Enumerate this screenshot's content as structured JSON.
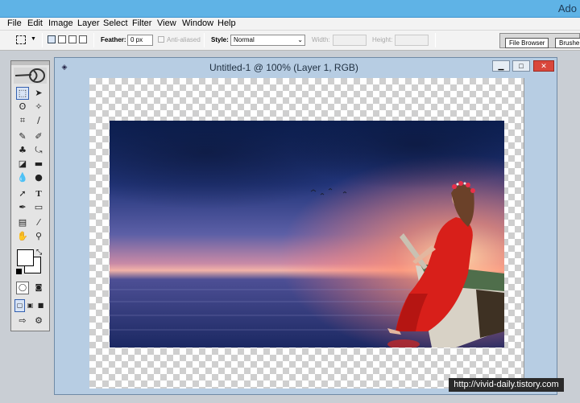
{
  "app": {
    "title": "Ado"
  },
  "menu": [
    "File",
    "Edit",
    "Image",
    "Layer",
    "Select",
    "Filter",
    "View",
    "Window",
    "Help"
  ],
  "options": {
    "feather_label": "Feather:",
    "feather_value": "0 px",
    "antialiased_label": "Anti-aliased",
    "style_label": "Style:",
    "style_value": "Normal",
    "width_label": "Width:",
    "height_label": "Height:"
  },
  "palette_well": {
    "tabs": [
      "File Browser",
      "Brushe"
    ]
  },
  "document": {
    "title": "Untitled-1 @ 100% (Layer 1, RGB)"
  },
  "colors": {
    "foreground": "#ffffff",
    "background": "#ffffff"
  },
  "watermark": "http://vivid-daily.tistory.com"
}
